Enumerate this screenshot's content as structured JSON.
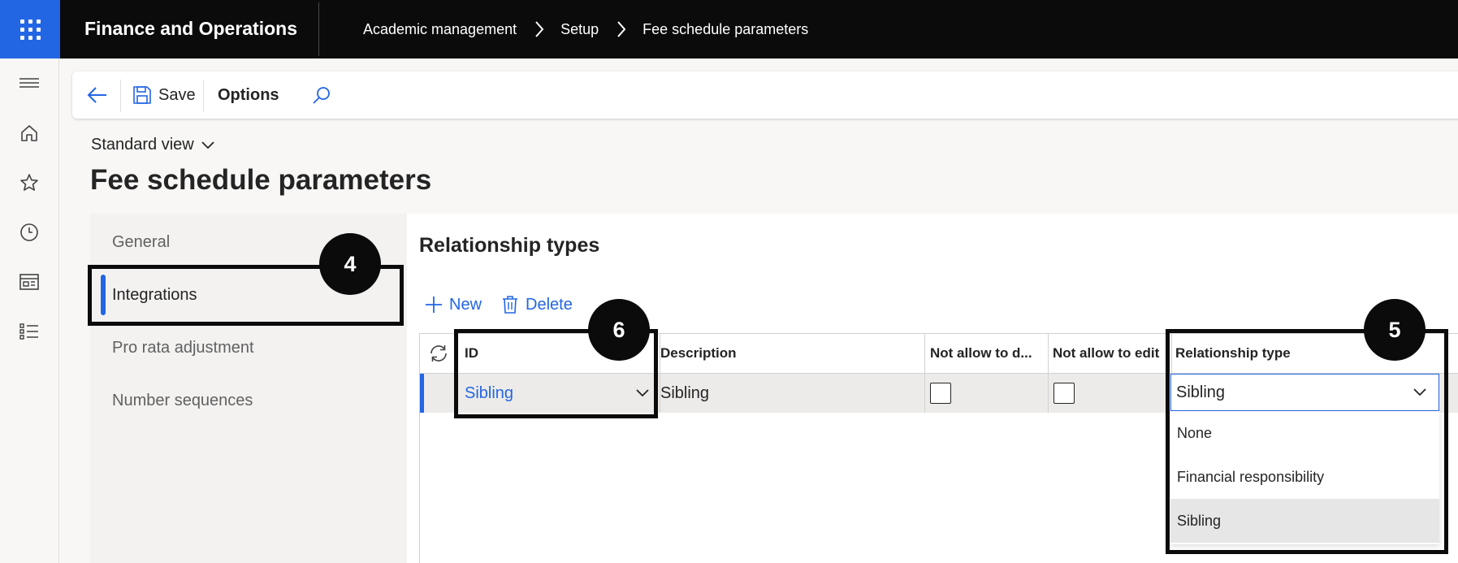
{
  "app": {
    "title": "Finance and Operations"
  },
  "breadcrumb": [
    "Academic management",
    "Setup",
    "Fee schedule parameters"
  ],
  "rail": {
    "icons": [
      "hamburger-icon",
      "home-icon",
      "star-icon",
      "clock-icon",
      "workspace-icon",
      "list-icon"
    ]
  },
  "actionpane": {
    "save_label": "Save",
    "options_label": "Options"
  },
  "view": {
    "label": "Standard view"
  },
  "page": {
    "title": "Fee schedule parameters"
  },
  "tabs": [
    "General",
    "Integrations",
    "Pro rata adjustment",
    "Number sequences"
  ],
  "active_tab": "Integrations",
  "section": {
    "title": "Relationship types"
  },
  "toolbar": {
    "new_label": "New",
    "delete_label": "Delete"
  },
  "grid": {
    "columns": [
      "ID",
      "Description",
      "Not allow to d...",
      "Not allow to edit",
      "Relationship type"
    ],
    "rows": [
      {
        "id": "Sibling",
        "description": "Sibling",
        "not_allow_delete": false,
        "not_allow_edit": false,
        "relationship_type": "Sibling"
      }
    ]
  },
  "dropdown": {
    "options": [
      "None",
      "Financial responsibility",
      "Sibling"
    ],
    "selected": "Sibling"
  },
  "callouts": [
    "4",
    "6",
    "5"
  ],
  "colors": {
    "accent": "#2266e3",
    "topbar": "#0b0b0b",
    "callout": "#0b0b0b"
  }
}
